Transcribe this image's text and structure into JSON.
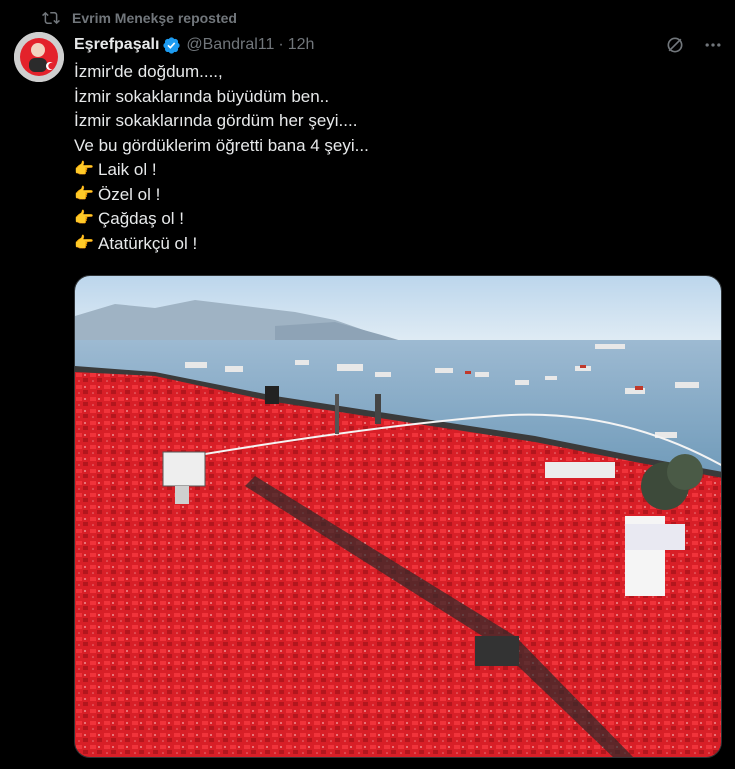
{
  "repost": {
    "text": "Evrim Menekşe reposted",
    "icon": "repost-icon"
  },
  "tweet": {
    "display_name": "Eşrefpaşalı",
    "handle": "@Bandral11",
    "separator": "·",
    "time": "12h",
    "verified_icon": "verified-badge-icon",
    "lines": [
      "İzmir'de doğdum....,",
      "İzmir sokaklarında büyüdüm ben..",
      "İzmir sokaklarında gördüm her şeyi....",
      "Ve bu gördüklerim öğretti bana 4 şeyi..."
    ],
    "pointing_emoji": "👉",
    "items": [
      "Laik ol !",
      "Özel ol !",
      "Çağdaş ol !",
      "Atatürkçü ol !"
    ]
  },
  "colors": {
    "background": "#000000",
    "text": "#e7e9ea",
    "muted": "#71767b",
    "verified": "#1d9bf0",
    "crowd_red": "#e0262c",
    "sea": "#7aa7c9"
  }
}
